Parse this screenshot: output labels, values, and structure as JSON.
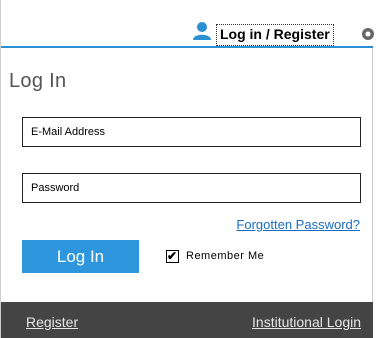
{
  "header": {
    "icon": "user-icon",
    "toggle_label": "Log in / Register",
    "settings_icon": "gear-icon",
    "accent_color": "#2a8fd3"
  },
  "login": {
    "title": "Log In",
    "email_placeholder": "E-Mail Address",
    "password_placeholder": "Password",
    "forgot_label": "Forgotten Password?",
    "submit_label": "Log In",
    "remember_label": "Remember Me",
    "remember_checked": true,
    "button_color": "#2d96dc"
  },
  "footer": {
    "register_label": "Register",
    "institutional_label": "Institutional Login",
    "background_color": "#444444"
  }
}
